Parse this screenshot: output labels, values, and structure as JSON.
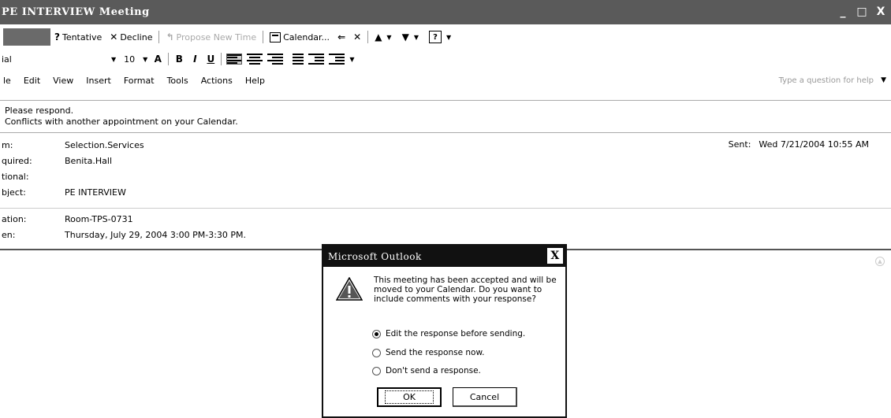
{
  "window": {
    "title": "PE INTERVIEW  Meeting",
    "minimize": "_",
    "maximize": "□",
    "close": "X"
  },
  "toolbar": {
    "tentative": "Tentative",
    "decline": "Decline",
    "propose": "Propose New Time",
    "calendar": "Calendar...",
    "delete": "✕",
    "help": "?"
  },
  "format": {
    "font": "ial",
    "size": "10",
    "bold": "B",
    "italic": "I",
    "underline": "U"
  },
  "menu": {
    "items": [
      {
        "label": "le",
        "acc": ""
      },
      {
        "label": "Edit",
        "acc": "E"
      },
      {
        "label": "View",
        "acc": "V"
      },
      {
        "label": "Insert",
        "acc": "I"
      },
      {
        "label": "Format",
        "acc": "o"
      },
      {
        "label": "Tools",
        "acc": "T"
      },
      {
        "label": "Actions",
        "acc": "A"
      },
      {
        "label": "Help",
        "acc": "H"
      }
    ],
    "ask_placeholder": "Type a question for help"
  },
  "infobar": {
    "line1": "Please respond.",
    "line2": "Conflicts with another appointment on your Calendar."
  },
  "message": {
    "from_label": "m:",
    "from": "Selection.Services",
    "required_label": "quired:",
    "required": "Benita.Hall",
    "optional_label": "tional:",
    "optional": "",
    "subject_label": "bject:",
    "subject": "PE INTERVIEW",
    "location_label": "ation:",
    "location": "Room-TPS-0731",
    "when_label": "en:",
    "when": "Thursday, July 29, 2004 3:00 PM-3:30 PM.",
    "sent_label": "Sent:",
    "sent": "Wed 7/21/2004 10:55 AM"
  },
  "dialog": {
    "title": "Microsoft Outlook",
    "close": "X",
    "message": "This meeting has been accepted and will be moved to your Calendar. Do you want to include comments with your response?",
    "options": [
      {
        "label": "Edit the response before sending.",
        "selected": true
      },
      {
        "label": "Send the response now.",
        "selected": false
      },
      {
        "label": "Don't send a response.",
        "selected": false
      }
    ],
    "ok": "OK",
    "cancel": "Cancel"
  }
}
